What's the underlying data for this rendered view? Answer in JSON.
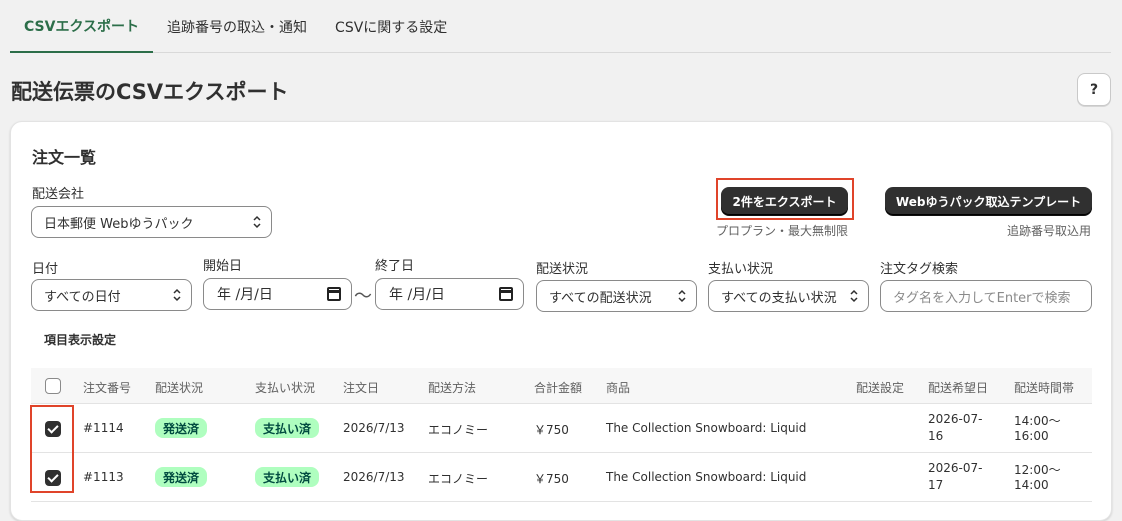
{
  "tabs": [
    "CSVエクスポート",
    "追跡番号の取込・通知",
    "CSVに関する設定"
  ],
  "page_title": "配送伝票のCSVエクスポート",
  "help_label": "?",
  "card": {
    "title": "注文一覧",
    "carrier_label": "配送会社",
    "carrier_value": "日本郵便 Webゆうパック",
    "export_button": "2件をエクスポート",
    "export_note": "プロプラン・最大無制限",
    "template_button": "Webゆうパック取込テンプレート",
    "template_note": "追跡番号取込用",
    "filters": {
      "date_label": "日付",
      "date_value": "すべての日付",
      "start_label": "開始日",
      "start_value": "年 /月/日",
      "end_label": "終了日",
      "end_value": "年 /月/日",
      "tilde": "〜",
      "ship_label": "配送状況",
      "ship_value": "すべての配送状況",
      "pay_label": "支払い状況",
      "pay_value": "すべての支払い状況",
      "tag_label": "注文タグ検索",
      "tag_placeholder": "タグ名を入力してEnterで検索"
    },
    "columns_link": "項目表示設定"
  },
  "table": {
    "headers": [
      "注文番号",
      "配送状況",
      "支払い状況",
      "注文日",
      "配送方法",
      "合計金額",
      "商品",
      "配送設定",
      "配送希望日",
      "配送時間帯"
    ],
    "rows": [
      {
        "order": "#1114",
        "ship": "発送済",
        "pay": "支払い済",
        "date": "2026/7/13",
        "method": "エコノミー",
        "total": "￥750",
        "product": "The Collection Snowboard: Liquid",
        "setting": "",
        "wish_date_1": "2026-07-",
        "wish_date_2": "16",
        "time_1": "14:00〜",
        "time_2": "16:00"
      },
      {
        "order": "#1113",
        "ship": "発送済",
        "pay": "支払い済",
        "date": "2026/7/13",
        "method": "エコノミー",
        "total": "￥750",
        "product": "The Collection Snowboard: Liquid",
        "setting": "",
        "wish_date_1": "2026-07-",
        "wish_date_2": "17",
        "time_1": "12:00〜",
        "time_2": "14:00"
      }
    ]
  },
  "colors": {
    "accent": "#2c6e49",
    "highlight": "#e0442a",
    "badge_bg": "#affebf",
    "button_dark": "#303030"
  }
}
